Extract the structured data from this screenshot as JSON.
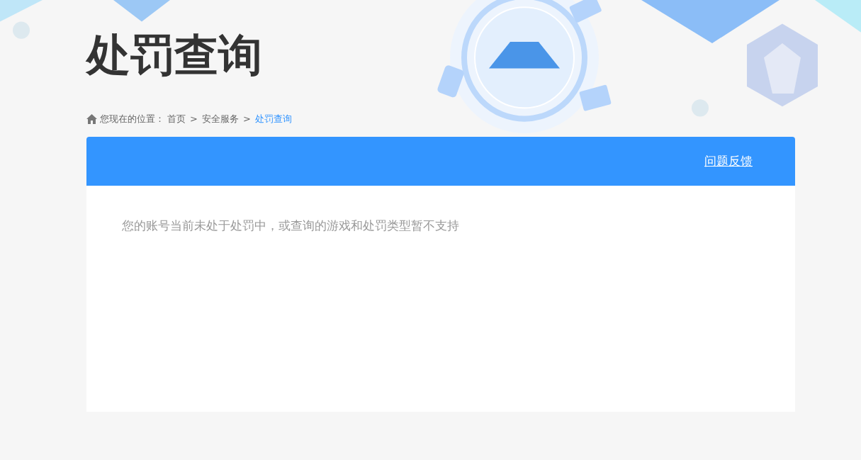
{
  "page_title": "处罚查询",
  "breadcrumb": {
    "prefix": "您现在的位置：",
    "items": [
      {
        "label": "首页",
        "current": false
      },
      {
        "label": "安全服务",
        "current": false
      },
      {
        "label": "处罚查询",
        "current": true
      }
    ],
    "separator": ">"
  },
  "panel": {
    "feedback_link": "问题反馈",
    "message": "您的账号当前未处于处罚中，或查询的游戏和处罚类型暂不支持"
  }
}
